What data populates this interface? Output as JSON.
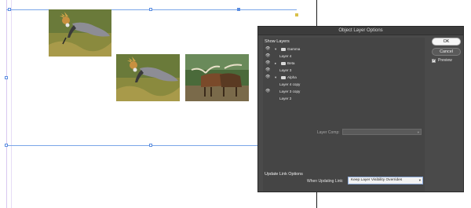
{
  "dialog": {
    "title": "Object Layer Options",
    "show_layers_label": "Show Layers",
    "layers": [
      {
        "name": "Gamma",
        "visible": true,
        "folder": true,
        "expanded": true
      },
      {
        "name": "Layer 4",
        "visible": true,
        "folder": false
      },
      {
        "name": "Beta",
        "visible": true,
        "folder": true,
        "expanded": false
      },
      {
        "name": "Layer 3",
        "visible": true,
        "folder": false
      },
      {
        "name": "Alpha",
        "visible": true,
        "folder": true,
        "expanded": true
      },
      {
        "name": "Layer 4 copy",
        "visible": false,
        "folder": false
      },
      {
        "name": "Layer 3 copy",
        "visible": true,
        "folder": false
      },
      {
        "name": "Layer 2",
        "visible": false,
        "folder": false
      }
    ],
    "layer_comp_label": "Layer Comp:",
    "layer_comp_value": "",
    "update_link_options_label": "Update Link Options",
    "when_updating_label": "When Updating Link:",
    "when_updating_value": "Keep Layer Visibility Overrides",
    "ok_label": "OK",
    "cancel_label": "Cancel",
    "preview_label": "Preview",
    "preview_checked": true
  },
  "images": [
    {
      "subject": "crowned crane"
    },
    {
      "subject": "crowned crane"
    },
    {
      "subject": "watusi cattle"
    }
  ],
  "colors": {
    "dialog_bg": "#4a4a4a",
    "frame_guide": "#7aa6e8"
  }
}
